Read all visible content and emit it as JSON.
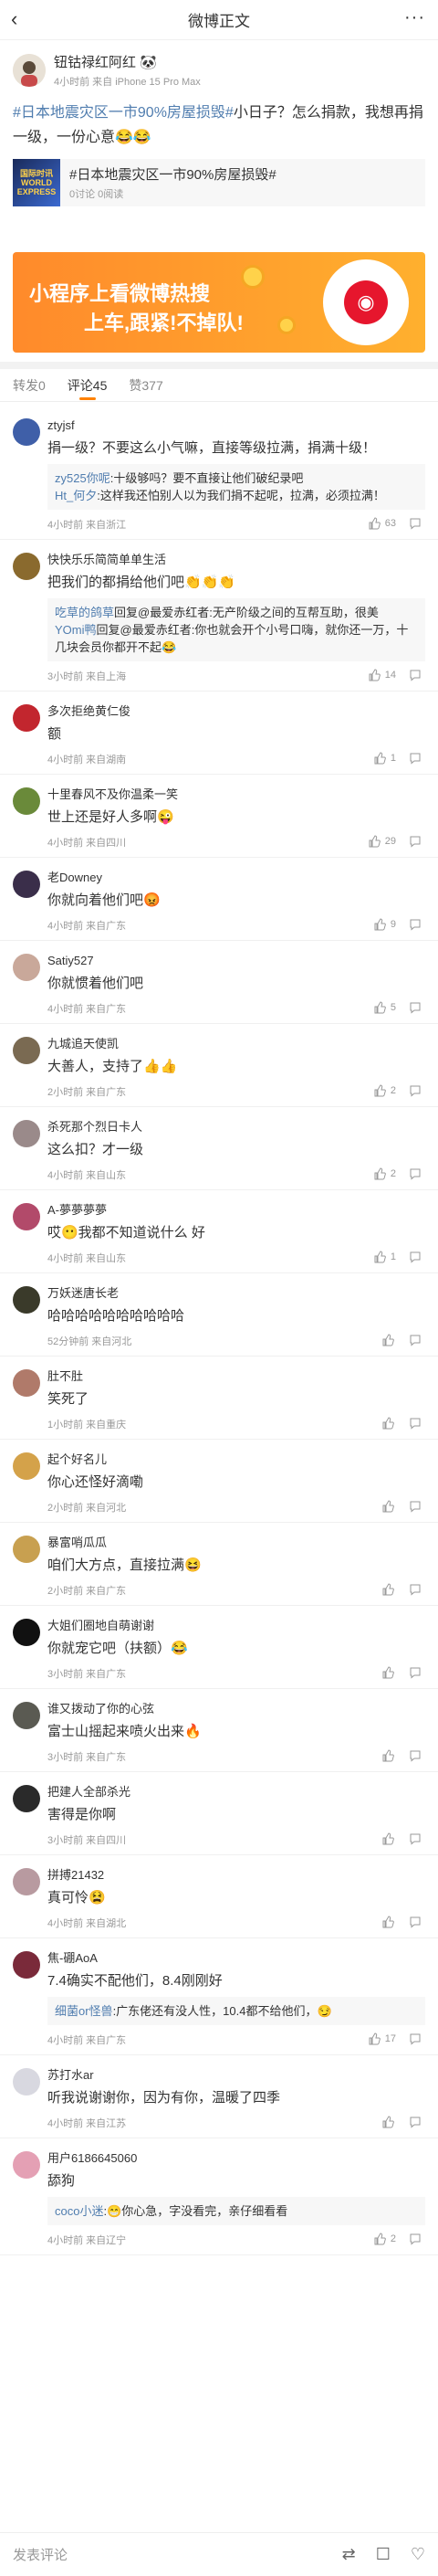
{
  "nav": {
    "title": "微博正文",
    "back": "‹",
    "more": "···"
  },
  "post": {
    "author": "钮钴禄红阿红",
    "author_emoji": "🐼",
    "meta": "4小时前 来自 iPhone 15 Pro Max",
    "topic": "#日本地震灾区一市90%房屋损毁#",
    "text": "小日子？怎么捐款，我想再捐一级，一份心意😂😂",
    "card_thumb": "国际时讯 WORLD EXPRESS",
    "card_title": "#日本地震灾区一市90%房屋损毁#",
    "card_sub": "0讨论 0阅读"
  },
  "banner": {
    "line1": "小程序上看微博热搜",
    "line2": "上车,跟紧!不掉队!"
  },
  "tabs": [
    {
      "label": "转发0"
    },
    {
      "label": "评论45"
    },
    {
      "label": "赞377"
    }
  ],
  "comments": [
    {
      "name": "ztyjsf",
      "text": "捐一级？不要这么小气嘛，直接等级拉满，捐满十级！",
      "replies": [
        {
          "rn": "zy525你呢",
          "rt": ":十级够吗？要不直接让他们破纪录吧"
        },
        {
          "rn": "Ht_何夕",
          "rt": ":这样我还怕别人以为我们捐不起呢，拉满，必须拉满！"
        }
      ],
      "meta": "4小时前 来自浙江",
      "likes": "63",
      "avatar_color": "#3f5fa8"
    },
    {
      "name": "快快乐乐简简单单生活",
      "text": "把我们的都捐给他们吧👏👏👏",
      "replies": [
        {
          "rn": "吃草的鸽草",
          "rt": "回复@最爱赤红者:无产阶级之间的互帮互助，很美"
        },
        {
          "rn": "YOmi鸭",
          "rt": "回复@最爱赤红者:你也就会开个小号口嗨，就你还一万，十几块会员你都开不起😂"
        }
      ],
      "meta": "3小时前 来自上海",
      "likes": "14",
      "avatar_color": "#8a6a2e"
    },
    {
      "name": "多次拒绝黄仁俊",
      "text": "额",
      "replies": [],
      "meta": "4小时前 来自湖南",
      "likes": "1",
      "avatar_color": "#c2262e"
    },
    {
      "name": "十里春风不及你温柔一笑",
      "text": "世上还是好人多啊😜",
      "replies": [],
      "meta": "4小时前 来自四川",
      "likes": "29",
      "avatar_color": "#6a8a3a"
    },
    {
      "name": "老Downey",
      "text": "你就向着他们吧😡",
      "replies": [],
      "meta": "4小时前 来自广东",
      "likes": "9",
      "avatar_color": "#3a2e4a"
    },
    {
      "name": "Satiy527",
      "text": "你就惯着他们吧",
      "replies": [],
      "meta": "4小时前 来自广东",
      "likes": "5",
      "avatar_color": "#c9a89a"
    },
    {
      "name": "九城追天使凯",
      "text": "大善人，支持了👍👍",
      "replies": [],
      "meta": "2小时前 来自广东",
      "likes": "2",
      "avatar_color": "#7a6a52"
    },
    {
      "name": "杀死那个烈日卡人",
      "text": "这么扣？才一级",
      "replies": [],
      "meta": "4小时前 来自山东",
      "likes": "2",
      "avatar_color": "#9a8a8a"
    },
    {
      "name": "A-夢夢夢夢",
      "text": "哎😶我都不知道说什么 好",
      "replies": [],
      "meta": "4小时前 来自山东",
      "likes": "1",
      "avatar_color": "#b24a6a"
    },
    {
      "name": "万妖迷唐长老",
      "text": "哈哈哈哈哈哈哈哈哈哈",
      "replies": [],
      "meta": "52分钟前 来自河北",
      "likes": "",
      "avatar_color": "#3a3a2a"
    },
    {
      "name": "肚不肚",
      "text": "笑死了",
      "replies": [],
      "meta": "1小时前 来自重庆",
      "likes": "",
      "avatar_color": "#b07a6a"
    },
    {
      "name": "起个好名儿",
      "text": "你心还怪好滴嘞",
      "replies": [],
      "meta": "2小时前 来自河北",
      "likes": "",
      "avatar_color": "#d4a24a"
    },
    {
      "name": "暴富哨瓜瓜",
      "text": "咱们大方点，直接拉满😆",
      "replies": [],
      "meta": "2小时前 来自广东",
      "likes": "",
      "avatar_color": "#c8a050"
    },
    {
      "name": "大姐们圈地自萌谢谢",
      "text": "你就宠它吧（扶额）😂",
      "replies": [],
      "meta": "3小时前 来自广东",
      "likes": "",
      "avatar_color": "#111111"
    },
    {
      "name": "谁又拨动了你的心弦",
      "text": "富士山摇起来喷火出来🔥",
      "replies": [],
      "meta": "3小时前 来自广东",
      "likes": "",
      "avatar_color": "#5a5a52"
    },
    {
      "name": "把建人全部杀光",
      "text": "害得是你啊",
      "replies": [],
      "meta": "3小时前 来自四川",
      "likes": "",
      "avatar_color": "#2a2a2a"
    },
    {
      "name": "拼搏21432",
      "text": "真可怜😫",
      "replies": [],
      "meta": "4小时前 来自湖北",
      "likes": "",
      "avatar_color": "#b89aa0"
    },
    {
      "name": "焦-硼AoA",
      "text": "7.4确实不配他们，8.4刚刚好",
      "replies": [
        {
          "rn": "细菌or怪兽",
          "rt": ":广东佬还有没人性，10.4都不给他们，😏"
        }
      ],
      "meta": "4小时前 来自广东",
      "likes": "17",
      "avatar_color": "#7a2a3a"
    },
    {
      "name": "苏打水ar",
      "text": "听我说谢谢你，因为有你，温暖了四季",
      "replies": [],
      "meta": "4小时前 来自江苏",
      "likes": "",
      "avatar_color": "#d8d8e0"
    },
    {
      "name": "用户6186645060",
      "text": "舔狗",
      "replies": [
        {
          "rn": "coco小迷",
          "rt": ":😁你心急，字没看完，亲仔细看看"
        }
      ],
      "meta": "4小时前 来自辽宁",
      "likes": "2",
      "avatar_color": "#e4a0b4"
    }
  ],
  "bottom": {
    "placeholder": "发表评论",
    "icons": [
      "repost-icon",
      "comment-icon",
      "like-icon"
    ]
  },
  "colors": {
    "accent": "#ff8200",
    "link": "#507daf"
  }
}
